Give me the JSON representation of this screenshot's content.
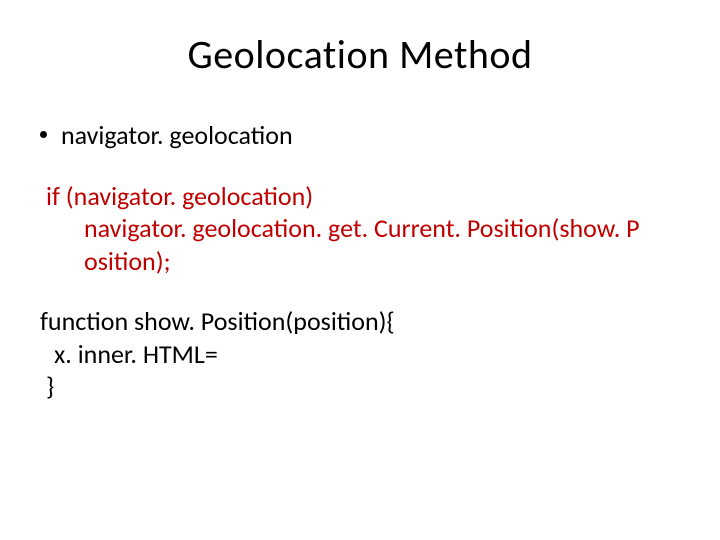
{
  "title": "Geolocation Method",
  "bullet": "navigator. geolocation",
  "code_red": {
    "line1": "if (navigator. geolocation)",
    "line2a": "navigator. geolocation. get. Current. Position(show. P",
    "line2b": "osition);"
  },
  "code_black": {
    "line1": "function show. Position(position){",
    "line2": "x. inner. HTML=",
    "line3": "}"
  }
}
